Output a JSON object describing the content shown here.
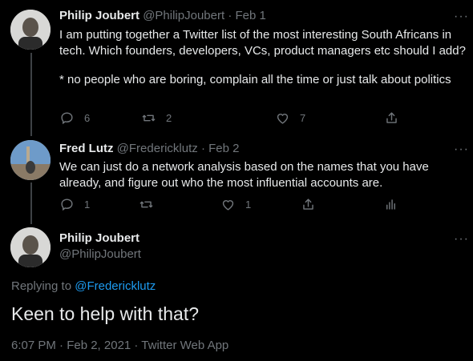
{
  "tweets": [
    {
      "name": "Philip Joubert",
      "handle": "@PhilipJoubert",
      "date": "· Feb 1",
      "text": [
        "I am putting together a Twitter list of the most interesting South Africans in tech. Which founders, developers, VCs, product managers etc should I add?",
        "* no people who are boring, complain all the time or just talk about politics"
      ],
      "replies": "6",
      "retweets": "2",
      "likes": "7"
    },
    {
      "name": "Fred Lutz",
      "handle": "@Fredericklutz",
      "date": "· Feb 2",
      "text": "We can just do a network analysis based on the names that you have already, and figure out who the most influential accounts are.",
      "replies": "1",
      "likes": "1"
    }
  ],
  "focus": {
    "name": "Philip Joubert",
    "handle": "@PhilipJoubert",
    "replying_label": "Replying to",
    "replying_handle": "@Fredericklutz",
    "text": "Keen to help with that?",
    "timestamp": "6:07 PM · Feb 2, 2021 · Twitter Web App"
  },
  "colors": {
    "link": "#1d9bf0",
    "muted": "#71767b",
    "background": "#000000"
  },
  "icons": [
    "more-icon",
    "reply-icon",
    "retweet-icon",
    "like-icon",
    "share-icon",
    "analytics-icon"
  ]
}
